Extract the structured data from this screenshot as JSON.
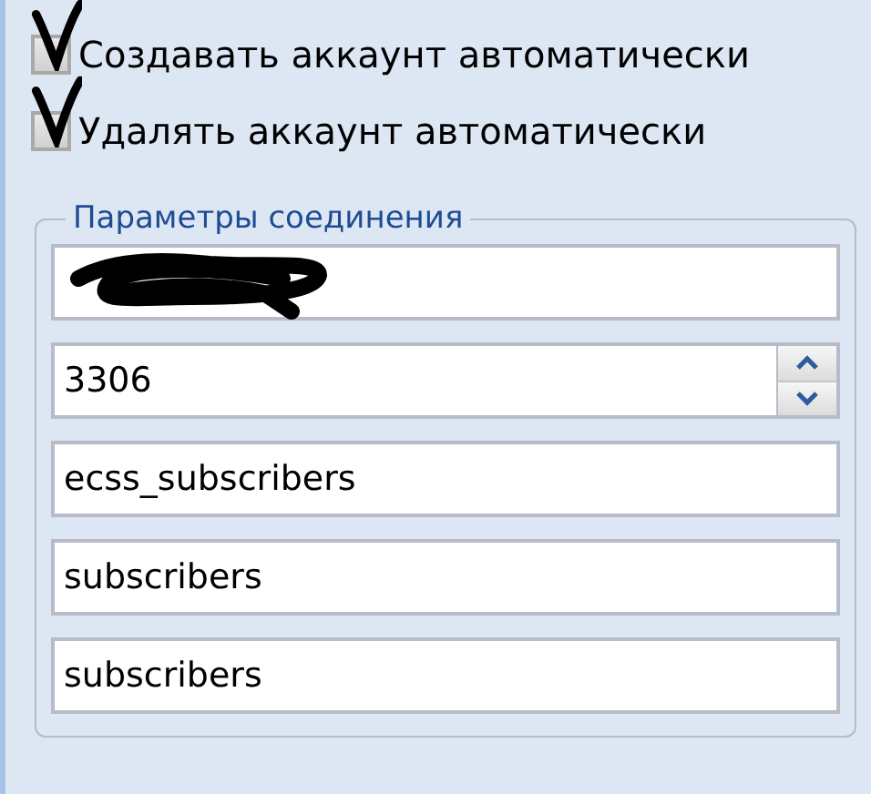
{
  "options": [
    {
      "label": "Создавать аккаунт автоматически",
      "checked": true
    },
    {
      "label": "Удалять аккаунт автоматически",
      "checked": true
    }
  ],
  "connection_group": {
    "title": "Параметры соединения",
    "fields": [
      {
        "kind": "redacted"
      },
      {
        "kind": "spinner",
        "value": "3306"
      },
      {
        "kind": "text",
        "value": "ecss_subscribers"
      },
      {
        "kind": "text",
        "value": "subscribers"
      },
      {
        "kind": "text",
        "value": "subscribers"
      }
    ]
  }
}
